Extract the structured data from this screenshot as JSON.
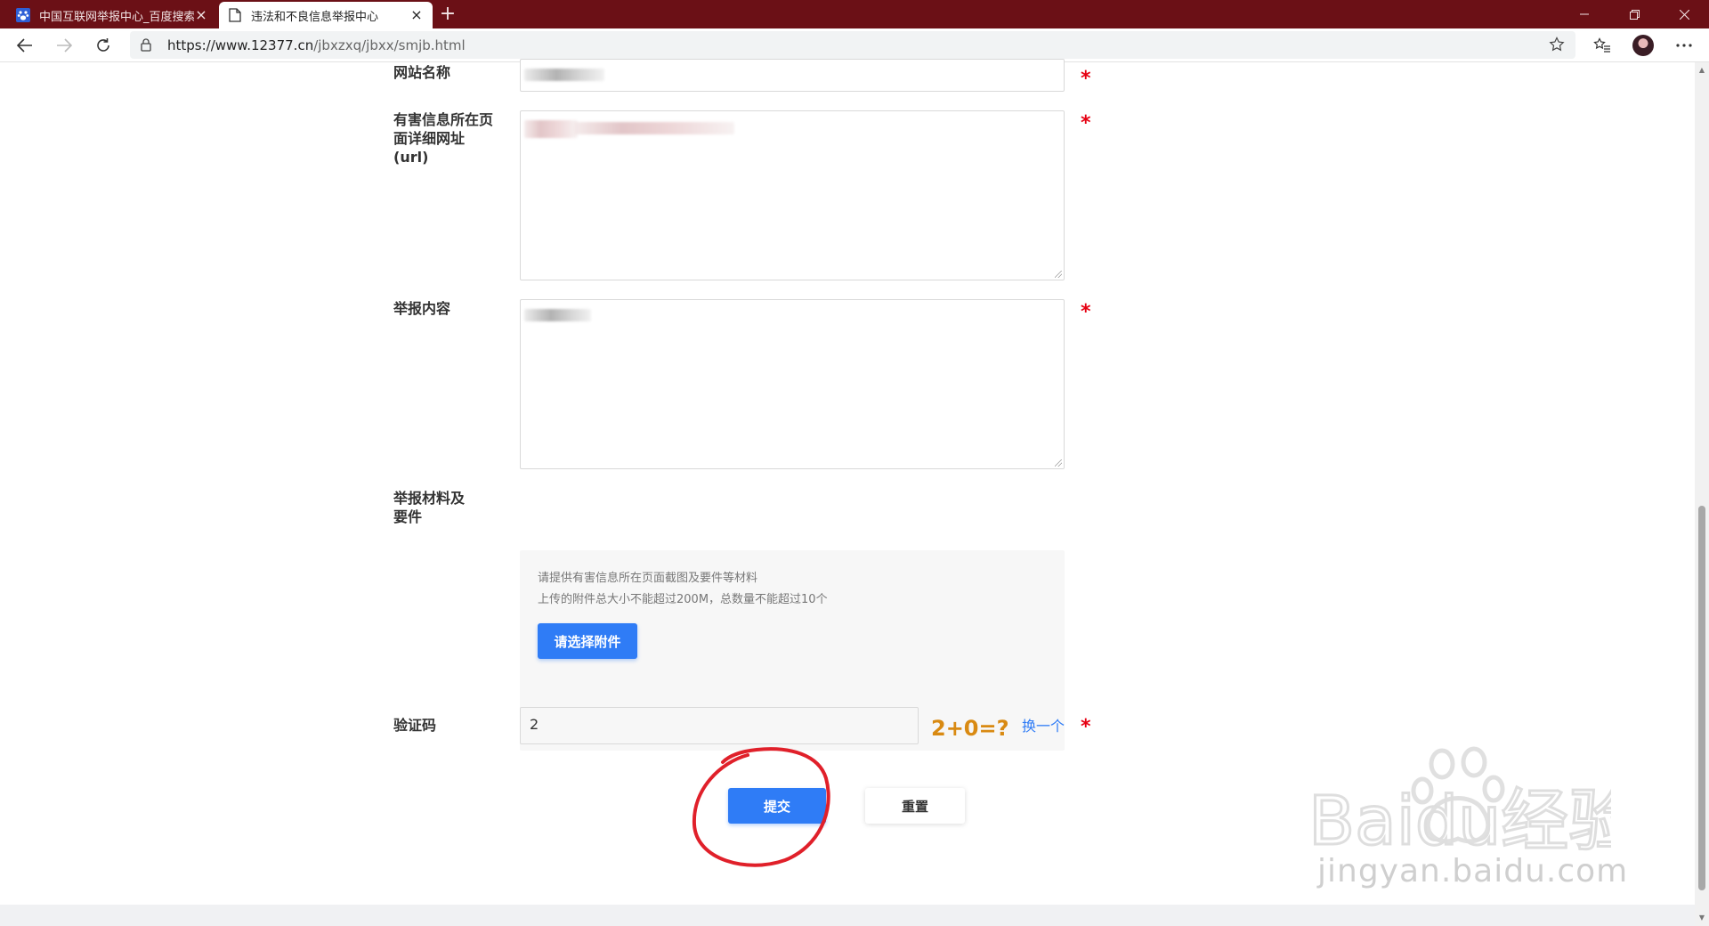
{
  "browser": {
    "tabs": [
      {
        "title": "中国互联网举报中心_百度搜索",
        "active": false
      },
      {
        "title": "违法和不良信息举报中心",
        "active": true
      }
    ],
    "url_host": "https://www.12377.cn",
    "url_path": "/jbxzxq/jbxx/smjb.html"
  },
  "form": {
    "site_name_label": "网站名称",
    "url_label": "有害信息所在页面详细网址(url)",
    "content_label": "举报内容",
    "materials_label": "举报材料及要件",
    "upload_hint_1": "请提供有害信息所在页面截图及要件等材料",
    "upload_hint_2": "上传的附件总大小不能超过200M，总数量不能超过10个",
    "upload_button": "请选择附件",
    "captcha_label": "验证码",
    "captcha_value": "2",
    "captcha_text": "2+0=?",
    "captcha_refresh": "换一个",
    "required_mark": "*",
    "submit_button": "提交",
    "reset_button": "重置"
  },
  "watermark": {
    "brand": "Baidu经验",
    "domain": "jingyan.baidu.com"
  },
  "colors": {
    "titlebar": "#6b1016",
    "primary": "#2f7cf6",
    "required": "#e60012",
    "annotation": "#e0202a"
  }
}
